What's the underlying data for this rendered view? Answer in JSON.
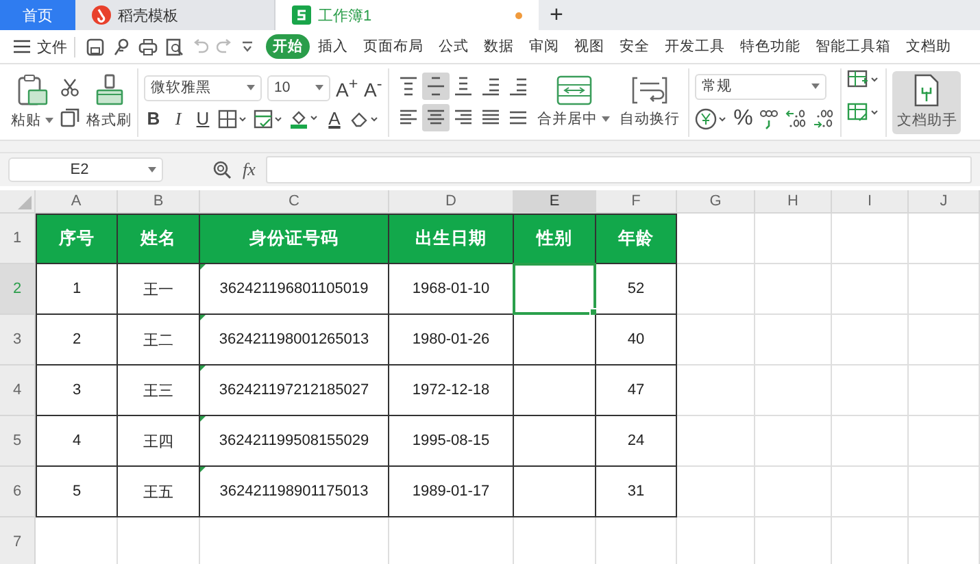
{
  "tabs": [
    {
      "label": "首页",
      "kind": "home",
      "selected": false,
      "unsaved": false
    },
    {
      "label": "稻壳模板",
      "kind": "docer",
      "selected": false,
      "unsaved": false
    },
    {
      "label": "工作簿1",
      "kind": "sheet",
      "selected": true,
      "unsaved": true
    }
  ],
  "new_tab": "+",
  "menu": {
    "file": "文件",
    "tabs": [
      {
        "label": "开始",
        "selected": true
      },
      {
        "label": "插入",
        "selected": false
      },
      {
        "label": "页面布局",
        "selected": false
      },
      {
        "label": "公式",
        "selected": false
      },
      {
        "label": "数据",
        "selected": false
      },
      {
        "label": "审阅",
        "selected": false
      },
      {
        "label": "视图",
        "selected": false
      },
      {
        "label": "安全",
        "selected": false
      },
      {
        "label": "开发工具",
        "selected": false
      },
      {
        "label": "特色功能",
        "selected": false
      },
      {
        "label": "智能工具箱",
        "selected": false
      },
      {
        "label": "文档助",
        "selected": false
      }
    ]
  },
  "ribbon": {
    "paste": "粘贴",
    "format_painter": "格式刷",
    "font": "微软雅黑",
    "font_size": "10",
    "grow_font": "A$^{+}$",
    "shrink_font": "A$^{-}$",
    "bold": "B",
    "italic": "I",
    "underline": "U",
    "font_color": "A",
    "align_buttons": [
      {
        "kind": "top",
        "selected": false
      },
      {
        "kind": "middle",
        "selected": true
      },
      {
        "kind": "bottom",
        "selected": false
      },
      {
        "kind": "indent-less",
        "selected": false
      },
      {
        "kind": "indent-more",
        "selected": false
      },
      {
        "kind": "left",
        "selected": false
      },
      {
        "kind": "center",
        "selected": true
      },
      {
        "kind": "right",
        "selected": false
      },
      {
        "kind": "justify",
        "selected": false
      },
      {
        "kind": "distributed",
        "selected": false
      }
    ],
    "merge": "合并居中",
    "wrap": "自动换行",
    "number_format": "常规",
    "percent": "%",
    "assistant": "文档助手"
  },
  "formula_bar": {
    "name_box": "E2",
    "fx": "fx"
  },
  "sheet": {
    "columns": [
      {
        "label": "A",
        "selected": false
      },
      {
        "label": "B",
        "selected": false
      },
      {
        "label": "C",
        "selected": false
      },
      {
        "label": "D",
        "selected": false
      },
      {
        "label": "E",
        "selected": true
      },
      {
        "label": "F",
        "selected": false
      },
      {
        "label": "G",
        "selected": false
      },
      {
        "label": "H",
        "selected": false
      },
      {
        "label": "I",
        "selected": false
      },
      {
        "label": "J",
        "selected": false
      }
    ],
    "rows": [
      {
        "number": "1",
        "selected": false,
        "kind": "header",
        "cells": [
          {
            "text": "序号",
            "selected": false,
            "flag": false
          },
          {
            "text": "姓名",
            "selected": false,
            "flag": false
          },
          {
            "text": "身份证号码",
            "selected": false,
            "flag": false
          },
          {
            "text": "出生日期",
            "selected": false,
            "flag": false
          },
          {
            "text": "性别",
            "selected": false,
            "flag": false
          },
          {
            "text": "年龄",
            "selected": false,
            "flag": false
          }
        ]
      },
      {
        "number": "2",
        "selected": true,
        "kind": "data",
        "cells": [
          {
            "text": "1",
            "selected": false,
            "flag": false
          },
          {
            "text": "王一",
            "selected": false,
            "flag": false
          },
          {
            "text": "362421196801105019",
            "selected": false,
            "flag": true
          },
          {
            "text": "1968-01-10",
            "selected": false,
            "flag": false
          },
          {
            "selected": true,
            "flag": false
          },
          {
            "text": "52",
            "selected": false,
            "flag": false
          }
        ]
      },
      {
        "number": "3",
        "selected": false,
        "kind": "data",
        "cells": [
          {
            "text": "2",
            "selected": false,
            "flag": false
          },
          {
            "text": "王二",
            "selected": false,
            "flag": false
          },
          {
            "text": "362421198001265013",
            "selected": false,
            "flag": true
          },
          {
            "text": "1980-01-26",
            "selected": false,
            "flag": false
          },
          {
            "selected": false,
            "flag": false
          },
          {
            "text": "40",
            "selected": false,
            "flag": false
          }
        ]
      },
      {
        "number": "4",
        "selected": false,
        "kind": "data",
        "cells": [
          {
            "text": "3",
            "selected": false,
            "flag": false
          },
          {
            "text": "王三",
            "selected": false,
            "flag": false
          },
          {
            "text": "362421197212185027",
            "selected": false,
            "flag": true
          },
          {
            "text": "1972-12-18",
            "selected": false,
            "flag": false
          },
          {
            "selected": false,
            "flag": false
          },
          {
            "text": "47",
            "selected": false,
            "flag": false
          }
        ]
      },
      {
        "number": "5",
        "selected": false,
        "kind": "data",
        "cells": [
          {
            "text": "4",
            "selected": false,
            "flag": false
          },
          {
            "text": "王四",
            "selected": false,
            "flag": false
          },
          {
            "text": "362421199508155029",
            "selected": false,
            "flag": true
          },
          {
            "text": "1995-08-15",
            "selected": false,
            "flag": false
          },
          {
            "selected": false,
            "flag": false
          },
          {
            "text": "24",
            "selected": false,
            "flag": false
          }
        ]
      },
      {
        "number": "6",
        "selected": false,
        "kind": "data",
        "cells": [
          {
            "text": "5",
            "selected": false,
            "flag": false
          },
          {
            "text": "王五",
            "selected": false,
            "flag": false
          },
          {
            "text": "362421198901175013",
            "selected": false,
            "flag": true
          },
          {
            "text": "1989-01-17",
            "selected": false,
            "flag": false
          },
          {
            "selected": false,
            "flag": false
          },
          {
            "text": "31",
            "selected": false,
            "flag": false
          }
        ]
      },
      {
        "number": "7",
        "selected": false,
        "kind": "empty",
        "cells": []
      }
    ]
  }
}
